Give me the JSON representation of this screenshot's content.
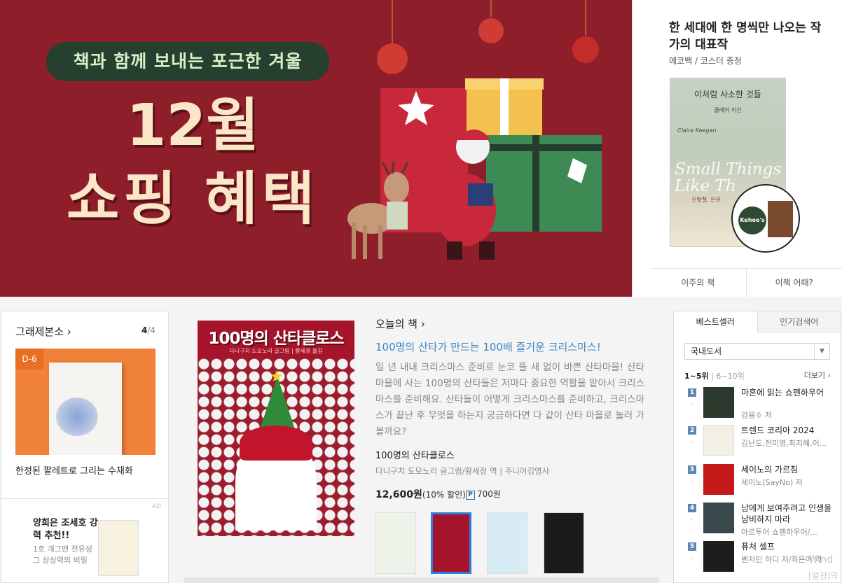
{
  "hero": {
    "pill": "책과 함께 보내는 포근한 겨울",
    "title_line1": "12월",
    "title_line2": "쇼핑 혜택"
  },
  "recommend": {
    "title": "한 세대에 한 명씩만 나오는 작가의 대표작",
    "subtitle": "에코백 / 코스터 증정",
    "cover_title": "이처럼 사소한 것들",
    "cover_author": "클레어 키건",
    "cover_en_author": "Claire Keegan",
    "cover_big": "Small Things Like Th",
    "cover_note": "신형철, 은유",
    "coaster_text": "Kehoe's",
    "tabs": [
      "이주의 책",
      "이책 어때?"
    ]
  },
  "gift_card": {
    "heading": "그래제본소",
    "page_current": "4",
    "page_total": "/4",
    "dday": "D-6",
    "caption": "한정된 팔레트로 그리는 수채화"
  },
  "ad_card": {
    "ad_label": "AD",
    "title": "양희은 조세호 강력 추천!!",
    "sub": "1호 개그맨 전유성 그 상상력의 비밀"
  },
  "today": {
    "section": "오늘의 책",
    "cover_title": "100명의 산타클로스",
    "cover_author": "다니구치 도모노리 글그림 | 황세정 옮김",
    "headline": "100명의 산타가 만드는 100배 즐거운 크리스마스!",
    "description": "일 년 내내 크리스마스 준비로 눈코 뜰 새 없이 바쁜 산타마을! 산타 마을에 사는 100명의 산타들은 저마다 중요한 역할을 맡아서 크리스마스를 준비해요. 산타들이 어떻게 크리스마스를 준비하고, 크리스마스가 끝난 후 무엇을 하는지 궁금하다면 다 같이 산타 마을로 놀러 가 볼까요?",
    "book_name": "100명의 산타클로스",
    "author_line": "다니구치 도모노리 글그림/황세정 역 | 주니어김영사",
    "price": "12,600원",
    "discount": "(10% 할인)",
    "point_icon": "P",
    "point": "700원"
  },
  "bestseller": {
    "tabs": [
      "베스트셀러",
      "인기검색어"
    ],
    "select": "국내도서",
    "range_on": "1~5위",
    "range_off": "6~10위",
    "more": "더보기",
    "items": [
      {
        "rank": "1",
        "title": "마흔에 읽는 쇼펜하우어",
        "author": "강용수 저",
        "cover_color": "#2c3a2e"
      },
      {
        "rank": "2",
        "title": "트렌드 코리아 2024",
        "author": "김난도,전미영,최지혜,이...",
        "cover_color": "#f3f0e6"
      },
      {
        "rank": "3",
        "title": "세이노의 가르침",
        "author": "세이노(SayNo) 저",
        "cover_color": "#c41a1a"
      },
      {
        "rank": "4",
        "title": "남에게 보여주려고 인생을 낭비하지 마라",
        "author": "아르투어 쇼펜하우어/...",
        "cover_color": "#3a4a4c"
      },
      {
        "rank": "5",
        "title": "퓨처 셀프",
        "author": "벤저민 하디 저/최은아 역",
        "cover_color": "#1d1d1d"
      }
    ]
  },
  "watermark": {
    "line1": "Wind",
    "line2": "[설정]의"
  }
}
